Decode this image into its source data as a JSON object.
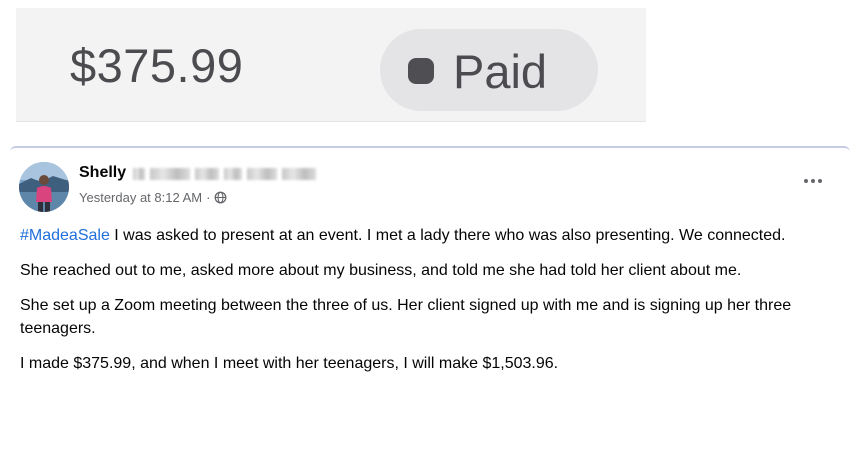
{
  "invoice": {
    "amount": "$375.99",
    "status_label": "Paid"
  },
  "post": {
    "author_first_name": "Shelly",
    "timestamp": "Yesterday at 8:12 AM",
    "separator": "·",
    "audience_icon": "globe-icon",
    "more_icon": "more-horizontal-icon",
    "hashtag": "#MadeaSale",
    "paragraph_1_rest": " I was asked to present at an event. I met a lady there who was also presenting. We connected.",
    "paragraph_2": "She reached out to me, asked more about my business, and told me she had told her client about me.",
    "paragraph_3": "She set up a Zoom meeting between the three of us.  Her client signed up with me and is signing up her three teenagers.",
    "paragraph_4": "I made $375.99, and when I meet with her teenagers, I will make $1,503.96."
  },
  "colors": {
    "hashtag": "#216fdb",
    "meta_text": "#65676b",
    "pill_bg": "#e4e4e6",
    "strip_bg": "#f3f3f4"
  }
}
